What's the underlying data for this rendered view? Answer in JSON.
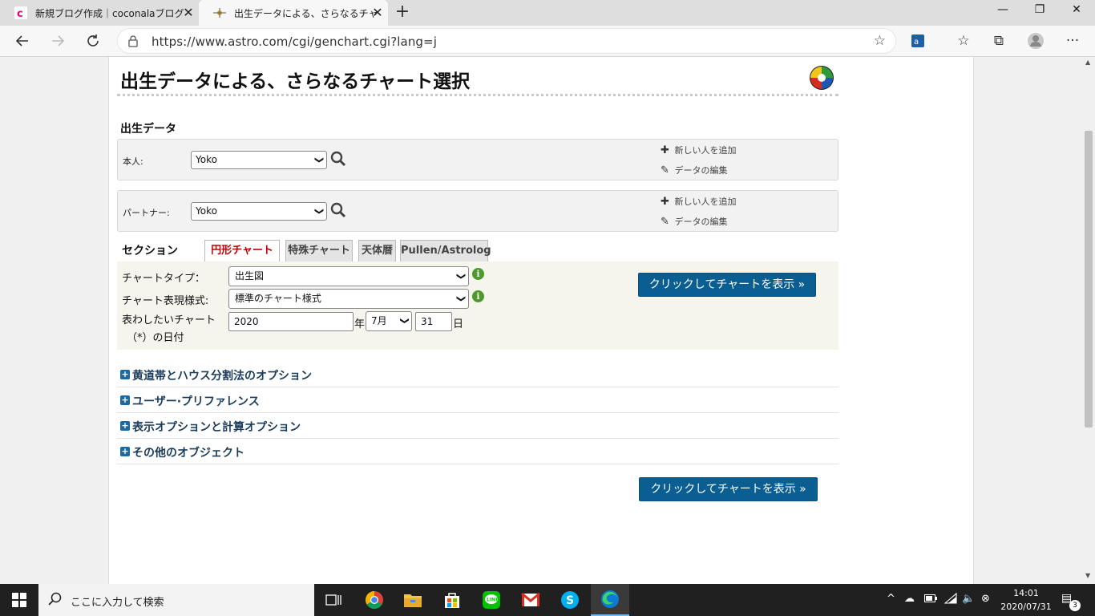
{
  "browser": {
    "tabs": [
      {
        "title": "新規ブログ作成｜coconalaブログ",
        "active": false
      },
      {
        "title": "出生データによる、さらなるチャート選択",
        "active": true
      }
    ],
    "new_tab": "+",
    "close_glyph": "✕",
    "window_controls": {
      "minimize": "—",
      "restore": "❐",
      "close": "✕"
    },
    "url": "https://www.astro.com/cgi/genchart.cgi?lang=j"
  },
  "page": {
    "title": "出生データによる、さらなるチャート選択",
    "birth_data_heading": "出生データ",
    "persons": [
      {
        "label": "本人:",
        "selected": "Yoko",
        "add_link": "新しい人を追加",
        "edit_link": "データの編集"
      },
      {
        "label": "パートナー:",
        "selected": "Yoko",
        "add_link": "新しい人を追加",
        "edit_link": "データの編集"
      }
    ],
    "section_label": "セクション",
    "section_tabs": [
      {
        "label": "円形チャート",
        "active": true
      },
      {
        "label": "特殊チャート",
        "active": false
      },
      {
        "label": "天体暦",
        "active": false
      },
      {
        "label": "Pullen/Astrolog",
        "active": false
      }
    ],
    "form": {
      "chart_type_label": "チャートタイプ：",
      "chart_type_value": "出生図",
      "chart_style_label": "チャート表現様式:",
      "chart_style_value": "標準のチャート様式",
      "date_label_line1": "表わしたいチャート",
      "date_label_line2": "（*）の日付",
      "year": "2020",
      "year_unit": "年",
      "month": "7月",
      "day": "31",
      "day_unit": "日",
      "info_glyph": "i"
    },
    "show_button": "クリックしてチャートを表示 »",
    "accordions": [
      "黄道帯とハウス分割法のオプション",
      "ユーザー·プリファレンス",
      "表示オプションと計算オプション",
      "その他のオブジェクト"
    ],
    "accordion_plus": "+"
  },
  "taskbar": {
    "search_placeholder": "ここに入力して検索",
    "time": "14:01",
    "date": "2020/07/31",
    "notification_count": "3"
  },
  "colors": {
    "accent_button": "#0a5e92",
    "active_tab_text": "#c00000",
    "accordion_icon": "#1d6aa0"
  }
}
